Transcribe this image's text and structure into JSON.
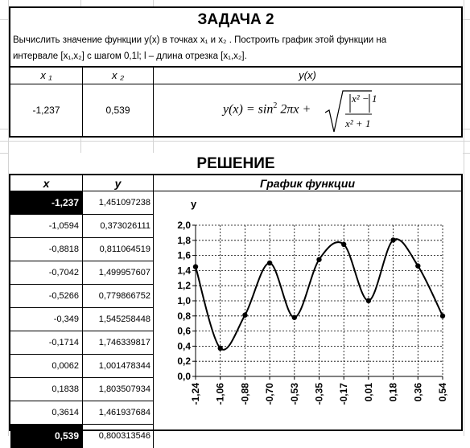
{
  "task": {
    "title": "ЗАДАЧА 2",
    "description_line1": "Вычислить значение функции y(x) в точках x₁  и x₂ . Построить график этой функции на",
    "description_line2": "интервале [x₁,x₂] с шагом 0,1l; l – длина отрезка [x₁,x₂].",
    "headers": [
      "x ₁",
      "x ₂",
      "y(x)"
    ],
    "x1_value": "-1,237",
    "x2_value": "0,539",
    "formula": {
      "lhs": "y(x) = sin",
      "power": "2",
      "arg": " 2πx +",
      "num": "x² − 1",
      "den": "x² + 1"
    }
  },
  "solution": {
    "title": "РЕШЕНИЕ",
    "col_x": "x",
    "col_y": "y",
    "col_chart": "График функции",
    "rows": [
      {
        "x": "-1,237",
        "y": "1,451097238"
      },
      {
        "x": "-1,0594",
        "y": "0,373026111"
      },
      {
        "x": "-0,8818",
        "y": "0,811064519"
      },
      {
        "x": "-0,7042",
        "y": "1,499957607"
      },
      {
        "x": "-0,5266",
        "y": "0,779866752"
      },
      {
        "x": "-0,349",
        "y": "1,545258448"
      },
      {
        "x": "-0,1714",
        "y": "1,746339817"
      },
      {
        "x": "0,0062",
        "y": "1,001478344"
      },
      {
        "x": "0,1838",
        "y": "1,803507934"
      },
      {
        "x": "0,3614",
        "y": "1,461937684"
      },
      {
        "x": "0,539",
        "y": "0,800313546"
      }
    ]
  },
  "chart_data": {
    "type": "line",
    "title": "",
    "xlabel": "",
    "ylabel": "y",
    "x": [
      -1.237,
      -1.0594,
      -0.8818,
      -0.7042,
      -0.5266,
      -0.349,
      -0.1714,
      0.0062,
      0.1838,
      0.3614,
      0.539
    ],
    "values": [
      1.451097238,
      0.373026111,
      0.811064519,
      1.499957607,
      0.779866752,
      1.545258448,
      1.746339817,
      1.001478344,
      1.803507934,
      1.461937684,
      0.800313546
    ],
    "x_tick_labels": [
      "-1,24",
      "-1,06",
      "-0,88",
      "-0,70",
      "-0,53",
      "-0,35",
      "-0,17",
      "0,01",
      "0,18",
      "0,36",
      "0,54"
    ],
    "y_tick_labels": [
      "0,0",
      "0,2",
      "0,4",
      "0,6",
      "0,8",
      "1,0",
      "1,2",
      "1,4",
      "1,6",
      "1,8",
      "2,0"
    ],
    "ylim": [
      0,
      2
    ],
    "grid": true,
    "smooth": true
  }
}
